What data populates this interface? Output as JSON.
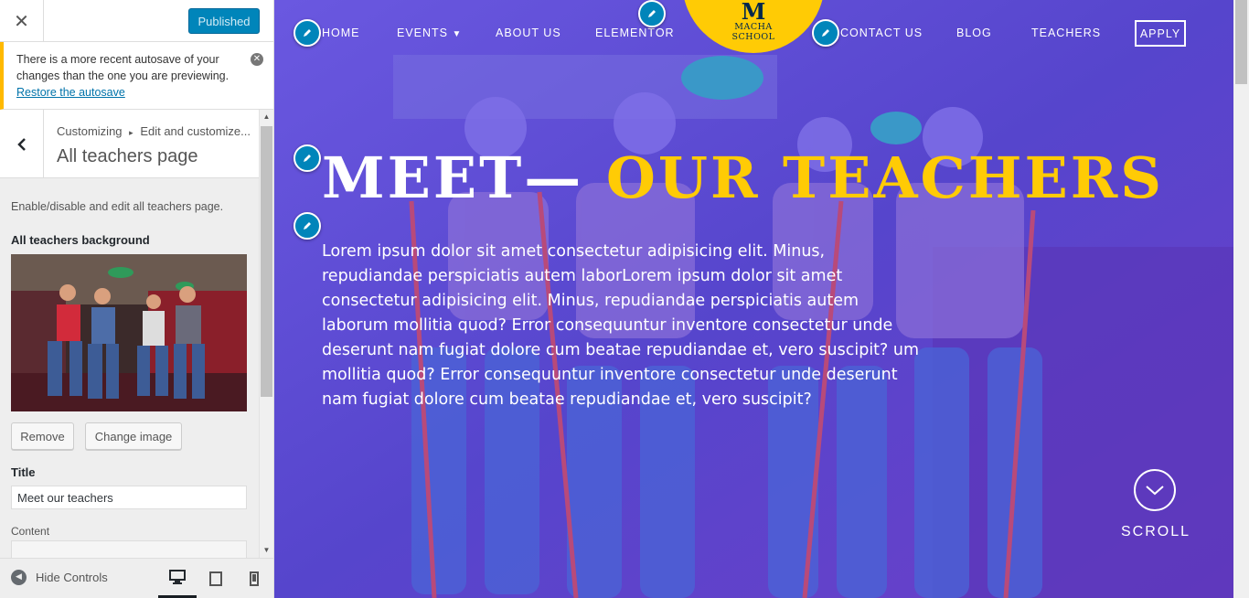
{
  "sidebar": {
    "close_icon": "close-icon",
    "publish_label": "Published",
    "notice": {
      "text": "There is a more recent autosave of your changes than the one you are previewing.",
      "link": "Restore the autosave"
    },
    "breadcrumb_root": "Customizing",
    "breadcrumb_sep": "▸",
    "breadcrumb_current": "Edit and customize...",
    "section_title": "All teachers page",
    "description": "Enable/disable and edit all teachers page.",
    "background": {
      "label": "All teachers background",
      "remove_label": "Remove",
      "change_label": "Change image"
    },
    "title_field": {
      "label": "Title",
      "value": "Meet our teachers"
    },
    "content_label": "Content",
    "footer": {
      "hide_controls": "Hide Controls"
    }
  },
  "preview": {
    "nav": {
      "items": [
        "HOME",
        "EVENTS",
        "ABOUT US",
        "ELEMENTOR",
        "CONTACT US",
        "BLOG",
        "TEACHERS"
      ],
      "events_caret": "▼",
      "apply": "APPLY"
    },
    "logo": {
      "letter": "M",
      "line1": "MACHA",
      "line2": "SCHOOL"
    },
    "hero": {
      "title_white": "MEET—",
      "title_yellow": "OUR TEACHERS",
      "body": "Lorem ipsum dolor sit amet consectetur adipisicing elit. Minus, repudiandae perspiciatis autem laborLorem ipsum dolor sit amet consectetur adipisicing elit. Minus, repudiandae perspiciatis autem laborum mollitia quod? Error consequuntur inventore consectetur unde deserunt nam fugiat dolore cum beatae repudiandae et, vero suscipit? um mollitia quod? Error consequuntur inventore consectetur unde deserunt nam fugiat dolore cum beatae repudiandae et, vero suscipit?"
    },
    "scroll_label": "SCROLL"
  },
  "colors": {
    "wp_blue": "#0085ba",
    "accent_yellow": "#ffcb05",
    "overlay_purple": "#5a49d8",
    "notice_border": "#ffb900"
  }
}
